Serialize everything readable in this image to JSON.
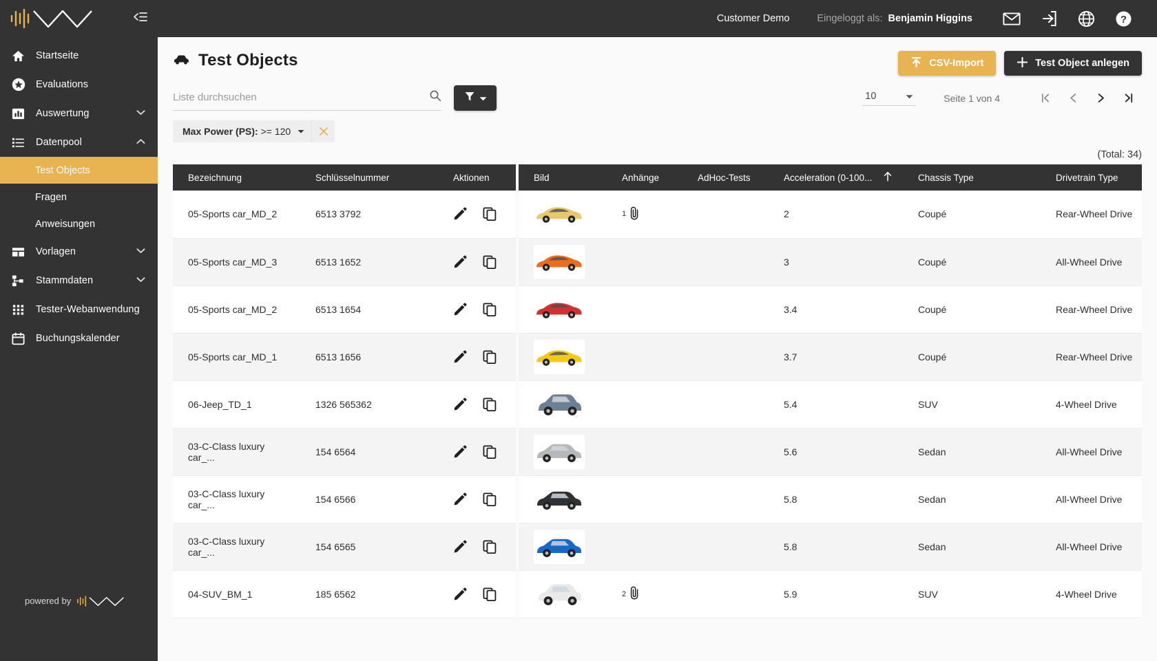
{
  "sidebar": {
    "logo_alt": "wave-logo",
    "collapse_icon": "collapse-panel-icon",
    "items": [
      {
        "label": "Startseite",
        "icon": "home-icon",
        "expandable": false
      },
      {
        "label": "Evaluations",
        "icon": "star-icon",
        "expandable": false
      },
      {
        "label": "Auswertung",
        "icon": "bar-chart-icon",
        "expandable": true,
        "expanded": false
      },
      {
        "label": "Datenpool",
        "icon": "list-icon",
        "expandable": true,
        "expanded": true
      }
    ],
    "sub_items": [
      {
        "label": "Test Objects",
        "active": true
      },
      {
        "label": "Fragen",
        "active": false
      },
      {
        "label": "Anweisungen",
        "active": false
      }
    ],
    "items_after": [
      {
        "label": "Vorlagen",
        "icon": "layout-icon",
        "expandable": true,
        "expanded": false
      },
      {
        "label": "Stammdaten",
        "icon": "hierarchy-icon",
        "expandable": true,
        "expanded": false
      },
      {
        "label": "Tester-Webanwendung",
        "icon": "grid-icon",
        "expandable": false
      },
      {
        "label": "Buchungskalender",
        "icon": "calendar-icon",
        "expandable": false
      }
    ],
    "powered_by": "powered by"
  },
  "topbar": {
    "tenant": "Customer Demo",
    "logged_in_label": "Eingeloggt als:",
    "user_name": "Benjamin Higgins",
    "icons": [
      "mail-icon",
      "logout-icon",
      "globe-icon",
      "help-icon"
    ]
  },
  "page": {
    "title": "Test Objects",
    "title_icon": "car-icon",
    "csv_import_label": "CSV-Import",
    "csv_import_icon": "upload-icon",
    "create_label": "Test Object anlegen",
    "create_icon": "plus-icon",
    "total_label": "(Total: 34)"
  },
  "search": {
    "placeholder": "Liste durchsuchen",
    "value": "",
    "icon": "search-icon",
    "filter_icon": "funnel-icon",
    "filter_caret": "chevron-down-icon"
  },
  "pagination": {
    "page_size": "10",
    "page_size_caret": "chevron-down-icon",
    "page_info": "Seite 1 von 4",
    "first_icon": "first-page-icon",
    "prev_icon": "prev-page-icon",
    "next_icon": "next-page-icon",
    "last_icon": "last-page-icon"
  },
  "filters": [
    {
      "label": "Max Power (PS):",
      "value": ">= 120",
      "caret": "chevron-down-icon",
      "remove_icon": "close-icon"
    }
  ],
  "table": {
    "columns": [
      {
        "label": "Bezeichnung",
        "sorted": false
      },
      {
        "label": "Schlüsselnummer",
        "sorted": false
      },
      {
        "label": "Aktionen",
        "sorted": false
      },
      {
        "label": "Bild",
        "sorted": false
      },
      {
        "label": "Anhänge",
        "sorted": false
      },
      {
        "label": "AdHoc-Tests",
        "sorted": false
      },
      {
        "label": "Acceleration (0-100...",
        "sorted": true,
        "sort_dir": "asc",
        "sort_icon": "arrow-up-icon"
      },
      {
        "label": "Chassis Type",
        "sorted": false
      },
      {
        "label": "Drivetrain Type",
        "sorted": false
      }
    ],
    "row_actions": [
      {
        "icon": "edit-pencil-icon",
        "name": "edit-row-button"
      },
      {
        "icon": "copy-icon",
        "name": "duplicate-row-button"
      }
    ],
    "rows": [
      {
        "bezeichnung": "05-Sports car_MD_2",
        "schluesselnummer": "6513 3792",
        "bild": "sports-car-yellow",
        "bild_color": "#e8c96a",
        "bild_shape": "coupe",
        "anhaenge": "1",
        "adhoc": "",
        "acceleration": "2",
        "chassis": "Coupé",
        "drivetrain": "Rear-Wheel Drive"
      },
      {
        "bezeichnung": "05-Sports car_MD_3",
        "schluesselnummer": "6513 1652",
        "bild": "sports-car-orange",
        "bild_color": "#ef6c1a",
        "bild_shape": "coupe",
        "anhaenge": "",
        "adhoc": "",
        "acceleration": "3",
        "chassis": "Coupé",
        "drivetrain": "All-Wheel Drive"
      },
      {
        "bezeichnung": "05-Sports car_MD_2",
        "schluesselnummer": "6513 1654",
        "bild": "sports-car-red",
        "bild_color": "#d0302f",
        "bild_shape": "coupe",
        "anhaenge": "",
        "adhoc": "",
        "acceleration": "3.4",
        "chassis": "Coupé",
        "drivetrain": "Rear-Wheel Drive"
      },
      {
        "bezeichnung": "05-Sports car_MD_1",
        "schluesselnummer": "6513 1656",
        "bild": "sports-car-yellow-stripes",
        "bild_color": "#f2cb12",
        "bild_shape": "coupe",
        "anhaenge": "",
        "adhoc": "",
        "acceleration": "3.7",
        "chassis": "Coupé",
        "drivetrain": "Rear-Wheel Drive"
      },
      {
        "bezeichnung": "06-Jeep_TD_1",
        "schluesselnummer": "1326 565362",
        "bild": "suv-blue-grey",
        "bild_color": "#6d7f93",
        "bild_shape": "suv",
        "anhaenge": "",
        "adhoc": "",
        "acceleration": "5.4",
        "chassis": "SUV",
        "drivetrain": "4-Wheel Drive"
      },
      {
        "bezeichnung": "03-C-Class luxury car_...",
        "schluesselnummer": "154 6564",
        "bild": "sedan-silver",
        "bild_color": "#b6b8ba",
        "bild_shape": "sedan",
        "anhaenge": "",
        "adhoc": "",
        "acceleration": "5.6",
        "chassis": "Sedan",
        "drivetrain": "All-Wheel Drive"
      },
      {
        "bezeichnung": "03-C-Class luxury car_...",
        "schluesselnummer": "154 6566",
        "bild": "sedan-black",
        "bild_color": "#2f3134",
        "bild_shape": "sedan",
        "anhaenge": "",
        "adhoc": "",
        "acceleration": "5.8",
        "chassis": "Sedan",
        "drivetrain": "All-Wheel Drive"
      },
      {
        "bezeichnung": "03-C-Class luxury car_...",
        "schluesselnummer": "154 6565",
        "bild": "sedan-blue",
        "bild_color": "#1668c9",
        "bild_shape": "sedan",
        "anhaenge": "",
        "adhoc": "",
        "acceleration": "5.8",
        "chassis": "Sedan",
        "drivetrain": "All-Wheel Drive"
      },
      {
        "bezeichnung": "04-SUV_BM_1",
        "schluesselnummer": "185 6562",
        "bild": "suv-white",
        "bild_color": "#e9e9ea",
        "bild_shape": "suv",
        "anhaenge": "2",
        "adhoc": "",
        "acceleration": "5.9",
        "chassis": "SUV",
        "drivetrain": "4-Wheel Drive"
      }
    ]
  }
}
